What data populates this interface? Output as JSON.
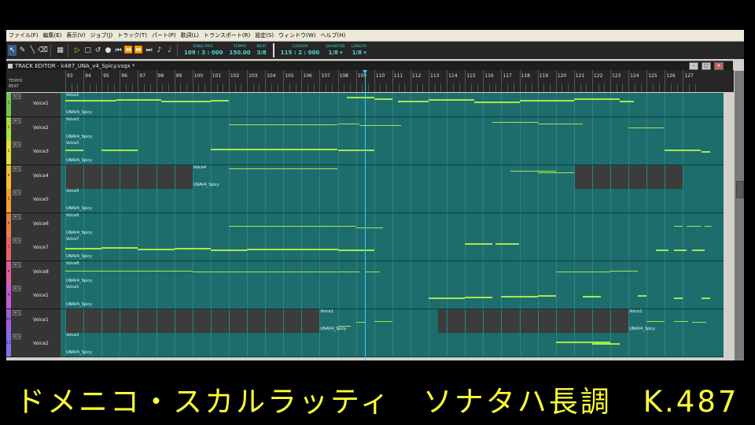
{
  "menu": [
    "ファイル(F)",
    "編集(E)",
    "表示(V)",
    "ジョブ(J)",
    "トラック(T)",
    "パート(P)",
    "歌詞(L)",
    "トランスポート(R)",
    "設定(S)",
    "ウィンドウ(W)",
    "ヘルプ(H)"
  ],
  "toolbar": {
    "song_pos": {
      "label": "SONG POS.",
      "value": "109 : 3 : 000"
    },
    "tempo": {
      "label": "TEMPO",
      "value": "150.00"
    },
    "beat": {
      "label": "BEAT",
      "value": "3/8"
    },
    "cursor": {
      "label": "CURSOR",
      "value": "115 : 2 : 000"
    },
    "quantize": {
      "label": "QUANTIZE",
      "value": "1/8 ▾"
    },
    "length": {
      "label": "LENGTH",
      "value": "1/8 ▾"
    }
  },
  "editor": {
    "title": "TRACK EDITOR - k487_UNA_v4_Spicy.vsqx *"
  },
  "ruler": {
    "tempo_label": "TEMPO",
    "beat_label": "BEAT",
    "measures": [
      93,
      94,
      95,
      96,
      97,
      98,
      99,
      100,
      101,
      102,
      103,
      104,
      105,
      106,
      107,
      108,
      109,
      110,
      111,
      112,
      113,
      114,
      115,
      116,
      117,
      118,
      119,
      120,
      121,
      122,
      123,
      124,
      125,
      126,
      127
    ],
    "cursor_measure": 109.5
  },
  "tracks": [
    {
      "num": "1",
      "name": "Voice1",
      "color": "#70c850",
      "part": "Voice1",
      "singer": "UNAV4_Spicy",
      "empty": []
    },
    {
      "num": "2",
      "name": "Voice2",
      "color": "#a8e040",
      "part": "Voice2",
      "singer": "UNAV4_Spicy",
      "empty": []
    },
    {
      "num": "3",
      "name": "Voice3",
      "color": "#e8e030",
      "part": "Voice3",
      "singer": "UNAV4_Spicy",
      "empty": []
    },
    {
      "num": "4",
      "name": "Voice4",
      "color": "#f0c030",
      "part": "Voice4",
      "singer": "UNAV4_Spicy",
      "empty": [
        [
          93,
          100
        ],
        [
          121,
          127
        ]
      ]
    },
    {
      "num": "5",
      "name": "Voice5",
      "color": "#f0a030",
      "part": "Voice5",
      "singer": "UNAV4_Spicy",
      "empty": []
    },
    {
      "num": "6",
      "name": "Voice6",
      "color": "#f08040",
      "part": "Voice6",
      "singer": "UNAV4_Spicy",
      "empty": []
    },
    {
      "num": "7",
      "name": "Voice7",
      "color": "#f06060",
      "part": "Voice7",
      "singer": "UNAV4_Spicy",
      "empty": []
    },
    {
      "num": "8",
      "name": "Voice8",
      "color": "#e060a0",
      "part": "Voice8",
      "singer": "UNAV4_Spicy",
      "empty": []
    },
    {
      "num": "9",
      "name": "Voice1",
      "color": "#c060d0",
      "part": "Voice1",
      "singer": "UNAV4_Spicy",
      "empty": []
    },
    {
      "num": "10",
      "name": "Voice1",
      "color": "#a060e0",
      "part": "Voice1",
      "singer": "UNAV4_Spicy",
      "empty": [
        [
          93,
          107
        ],
        [
          113.5,
          124
        ]
      ]
    },
    {
      "num": "11",
      "name": "Voice2",
      "color": "#8070f0",
      "part": "Voice2",
      "singer": "UNAV4_Spicy",
      "empty": []
    }
  ],
  "banner": {
    "text": "ドメニコ・スカルラッティ　ソナタハ長調　K.487"
  }
}
